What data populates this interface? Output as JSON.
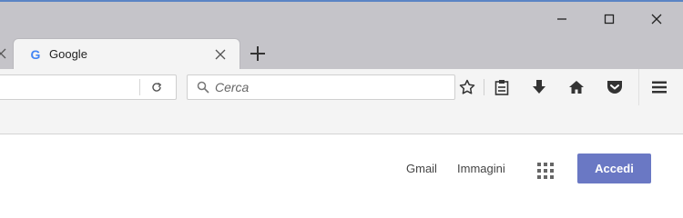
{
  "window": {
    "controls": {
      "minimize_icon": "minimize-icon",
      "maximize_icon": "maximize-icon",
      "close_icon": "close-icon"
    }
  },
  "tabs": [
    {
      "title": "Google",
      "favicon": "G",
      "active": true
    }
  ],
  "navbar": {
    "url_value": "",
    "search_placeholder": "Cerca"
  },
  "page": {
    "links": {
      "gmail": "Gmail",
      "images": "Immagini"
    },
    "signin_label": "Accedi"
  },
  "colors": {
    "titlebar": "#c5c4c9",
    "toolbar": "#f4f4f4",
    "accent_button": "#6a78c4",
    "window_top_border": "#5b84c4"
  }
}
